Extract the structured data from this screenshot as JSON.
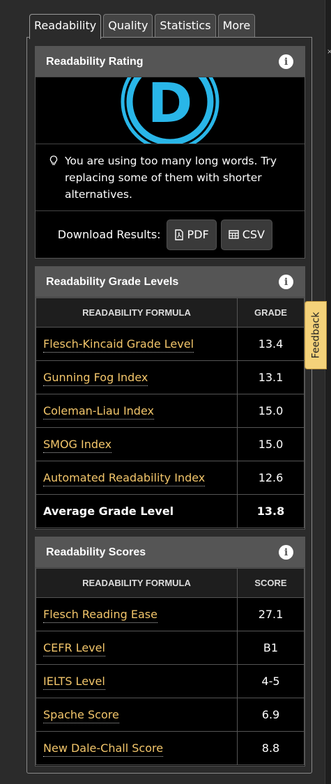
{
  "tabs": [
    {
      "label": "Readability",
      "active": true
    },
    {
      "label": "Quality"
    },
    {
      "label": "Statistics"
    },
    {
      "label": "More"
    }
  ],
  "rating": {
    "title": "Readability Rating",
    "grade_letter": "D",
    "badge_color": "#29b6e8",
    "tip": "You are using too many long words. Try replacing some of them with shorter alternatives.",
    "download_label": "Download Results:",
    "pdf_label": "PDF",
    "csv_label": "CSV"
  },
  "grade_levels": {
    "title": "Readability Grade Levels",
    "col_formula": "READABILITY FORMULA",
    "col_value": "GRADE",
    "rows": [
      {
        "name": "Flesch-Kincaid Grade Level",
        "value": "13.4"
      },
      {
        "name": "Gunning Fog Index",
        "value": "13.1"
      },
      {
        "name": "Coleman-Liau Index",
        "value": "15.0"
      },
      {
        "name": "SMOG Index",
        "value": "15.0"
      },
      {
        "name": "Automated Readability Index",
        "value": "12.6"
      }
    ],
    "average": {
      "name": "Average Grade Level",
      "value": "13.8"
    }
  },
  "scores": {
    "title": "Readability Scores",
    "col_formula": "READABILITY FORMULA",
    "col_value": "SCORE",
    "rows": [
      {
        "name": "Flesch Reading Ease",
        "value": "27.1"
      },
      {
        "name": "CEFR Level",
        "value": "B1"
      },
      {
        "name": "IELTS Level",
        "value": "4-5"
      },
      {
        "name": "Spache Score",
        "value": "6.9"
      },
      {
        "name": "New Dale-Chall Score",
        "value": "8.8"
      }
    ]
  },
  "feedback_label": "Feedback",
  "colors": {
    "link": "#f3c66b",
    "header": "#555555",
    "feedback_bg": "#f4d27a"
  }
}
